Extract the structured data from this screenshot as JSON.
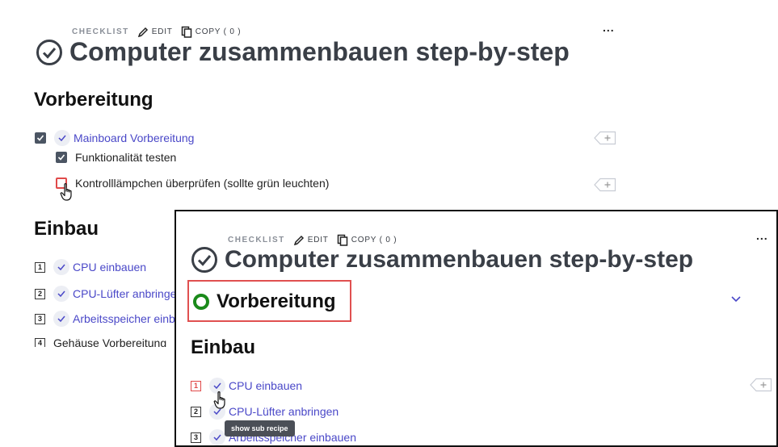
{
  "main": {
    "label": "CHECKLIST",
    "edit_label": "EDIT",
    "copy_label": "COPY ( 0 )",
    "more": "...",
    "title": "Computer zusammenbauen step-by-step",
    "section1": "Vorbereitung",
    "items1": [
      {
        "text": "Mainboard Vorbereitung"
      },
      {
        "text": "Funktionalität testen"
      },
      {
        "text": "Kontrolllämpchen überprüfen (sollte grün leuchten)"
      }
    ],
    "section2": "Einbau",
    "items2": [
      {
        "num": "1",
        "text": "CPU einbauen"
      },
      {
        "num": "2",
        "text": "CPU-Lüfter anbringen"
      },
      {
        "num": "3",
        "text": "Arbeitsspeicher einbauen"
      },
      {
        "num": "4",
        "text": "Gehäuse Vorbereitung"
      }
    ]
  },
  "overlay": {
    "label": "CHECKLIST",
    "edit_label": "EDIT",
    "copy_label": "COPY ( 0 )",
    "more": "...",
    "title": "Computer zusammenbauen step-by-step",
    "section1": "Vorbereitung",
    "section2": "Einbau",
    "items": [
      {
        "num": "1",
        "text": "CPU einbauen"
      },
      {
        "num": "2",
        "text": "CPU-Lüfter anbringen"
      },
      {
        "num": "3",
        "text": "Arbeitsspeicher einbauen"
      }
    ],
    "tooltip": "show sub recipe"
  },
  "colors": {
    "accent": "#4a48c8",
    "highlight": "#e05050",
    "status_green": "#1a8a1a"
  }
}
